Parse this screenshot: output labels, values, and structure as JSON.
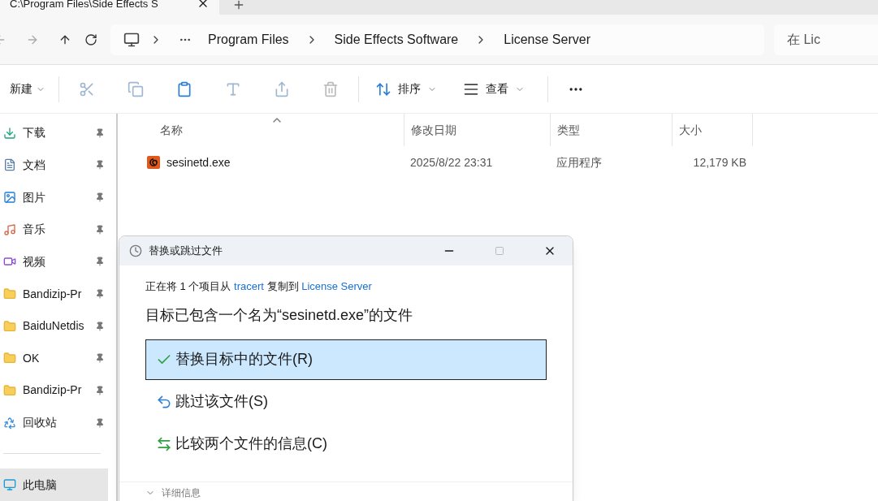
{
  "tab": {
    "title": "C:\\Program Files\\Side Effects S"
  },
  "breadcrumb": [
    "Program Files",
    "Side Effects Software",
    "License Server"
  ],
  "search": {
    "placeholder": "在 Lic"
  },
  "toolbar": {
    "new": "新建",
    "sort": "排序",
    "view": "查看"
  },
  "sidebar": {
    "items": [
      {
        "label": "下载",
        "kind": "download",
        "pinned": true,
        "selected": false
      },
      {
        "label": "文档",
        "kind": "document",
        "pinned": true,
        "selected": false
      },
      {
        "label": "图片",
        "kind": "picture",
        "pinned": true,
        "selected": false
      },
      {
        "label": "音乐",
        "kind": "music",
        "pinned": true,
        "selected": false
      },
      {
        "label": "视频",
        "kind": "video",
        "pinned": true,
        "selected": false
      },
      {
        "label": "Bandizip-Pr",
        "kind": "folder",
        "pinned": true,
        "selected": false
      },
      {
        "label": "BaiduNetdis",
        "kind": "folder",
        "pinned": true,
        "selected": false
      },
      {
        "label": "OK",
        "kind": "folder",
        "pinned": true,
        "selected": false
      },
      {
        "label": "Bandizip-Pr",
        "kind": "folder",
        "pinned": true,
        "selected": false
      },
      {
        "label": "回收站",
        "kind": "recycle",
        "pinned": true,
        "selected": false
      },
      {
        "label": "此电脑",
        "kind": "pc",
        "pinned": false,
        "selected": true
      }
    ]
  },
  "table": {
    "columns": [
      "名称",
      "修改日期",
      "类型",
      "大小"
    ],
    "rows": [
      {
        "name": "sesinetd.exe",
        "date": "2025/8/22 23:31",
        "type": "应用程序",
        "size": "12,179 KB"
      }
    ]
  },
  "dialog": {
    "title": "替换或跳过文件",
    "copy_prefix": "正在将 1 个项目从",
    "source": "tracert",
    "copy_middle": "复制到",
    "destination": "License Server",
    "heading": "目标已包含一个名为“sesinetd.exe”的文件",
    "options": [
      {
        "label": "替换目标中的文件(R)",
        "kind": "replace",
        "selected": true
      },
      {
        "label": "跳过该文件(S)",
        "kind": "skip",
        "selected": false
      },
      {
        "label": "比较两个文件的信息(C)",
        "kind": "compare",
        "selected": false
      }
    ],
    "details": "详细信息"
  }
}
